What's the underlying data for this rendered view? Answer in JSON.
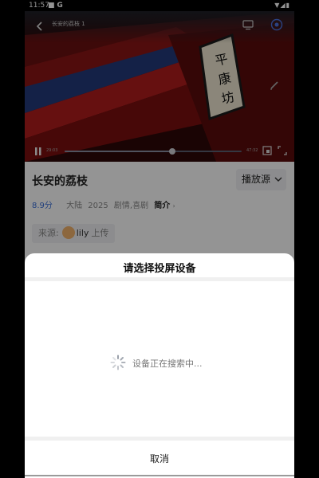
{
  "status_bar": {
    "time": "11:57",
    "left_icons": [
      "sim-card-icon",
      "google-icon"
    ],
    "right_icons": [
      "wifi-icon",
      "signal-icon",
      "battery-icon"
    ]
  },
  "player": {
    "title": "长安的荔枝 1",
    "current_time": "29:03",
    "total_time": "47:32",
    "progress": 0.61
  },
  "info": {
    "title": "长安的荔枝",
    "source_label": "播放源",
    "rating": "8.9分",
    "region": "大陆",
    "year": "2025",
    "genres": "剧情,喜剧",
    "intro_label": "简介",
    "intro_arrow": "›",
    "uploader_prefix": "来源:",
    "uploader_name": "lily",
    "uploader_suffix": "上传"
  },
  "cast_sheet": {
    "title": "请选择投屏设备",
    "status_text": "设备正在搜索中...",
    "cancel_label": "取消"
  },
  "colors": {
    "accent": "#3a6fd8",
    "video_bg": "#3a0a0a",
    "overlay": "rgba(0,0,0,0.42)"
  }
}
